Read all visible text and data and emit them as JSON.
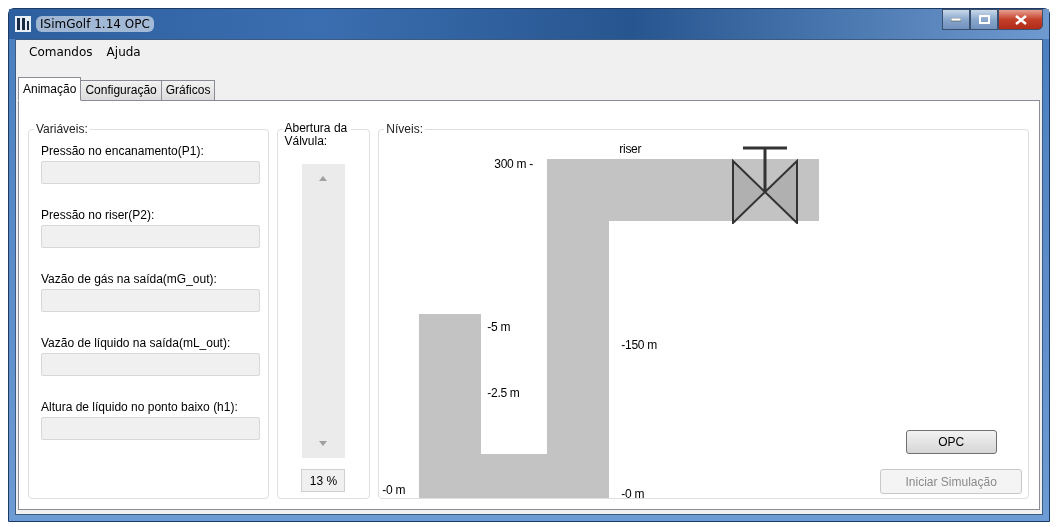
{
  "window": {
    "title": "ISimGolf 1.14 OPC"
  },
  "menu": [
    {
      "label": "Comandos"
    },
    {
      "label": "Ajuda"
    }
  ],
  "tabs": [
    {
      "label": "Animação",
      "selected": true
    },
    {
      "label": "Configuração",
      "selected": false
    },
    {
      "label": "Gráficos",
      "selected": false
    }
  ],
  "variables": {
    "title": "Variáveis:",
    "fields": [
      {
        "label": "Pressão no encanamento(P1):"
      },
      {
        "label": "Pressão no riser(P2):"
      },
      {
        "label": "Vazão de gás na saída(mG_out):"
      },
      {
        "label": "Vazão de líquido na saída(mL_out):"
      },
      {
        "label": "Altura de líquido no ponto baixo (h1):"
      }
    ]
  },
  "valve_opening": {
    "title": "Abertura da Válvula:",
    "reading": "13 %"
  },
  "levels": {
    "title": "Níveis:",
    "labels": [
      "300 m -",
      "riser",
      "-5 m",
      "-2.5 m",
      "-150 m",
      "-0 m",
      "-0 m"
    ]
  },
  "buttons": [
    {
      "label": "OPC",
      "disabled": false
    },
    {
      "label": "Iniciar Simulação",
      "disabled": true
    }
  ]
}
